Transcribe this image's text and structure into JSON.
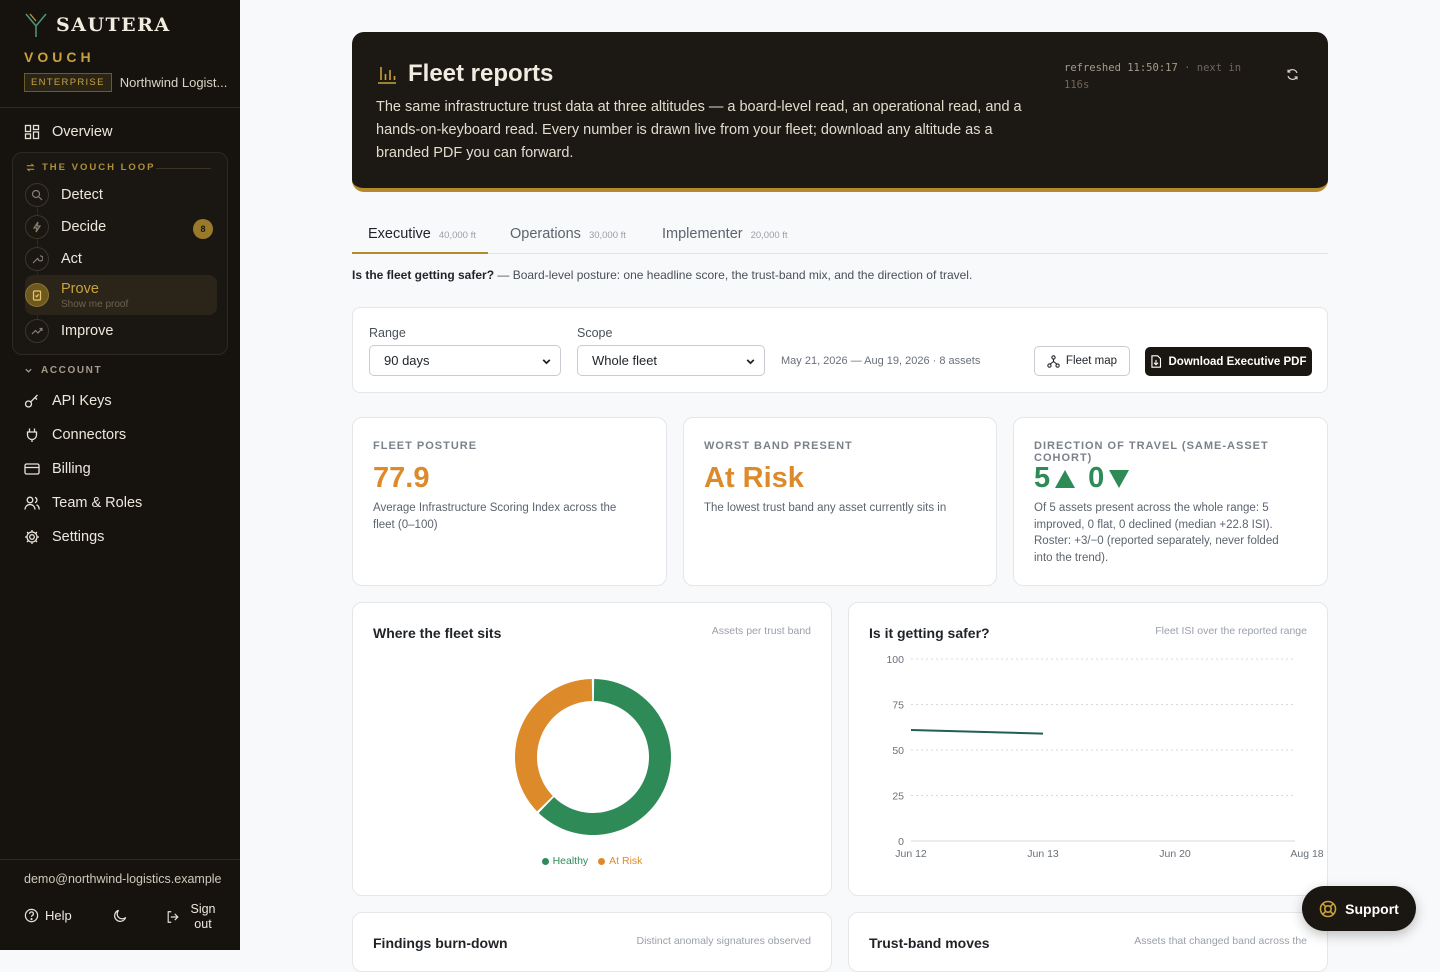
{
  "sidebar": {
    "brand": "SAUTERA",
    "product": "VOUCH",
    "tier": "ENTERPRISE",
    "org": "Northwind Logist...",
    "overview": "Overview",
    "loop_title": "THE VOUCH LOOP",
    "loop": [
      {
        "label": "Detect"
      },
      {
        "label": "Decide",
        "badge": "8"
      },
      {
        "label": "Act"
      },
      {
        "label": "Prove",
        "sub": "Show me proof"
      },
      {
        "label": "Improve"
      }
    ],
    "account_title": "ACCOUNT",
    "account": [
      {
        "label": "API Keys"
      },
      {
        "label": "Connectors"
      },
      {
        "label": "Billing"
      },
      {
        "label": "Team & Roles"
      },
      {
        "label": "Settings"
      }
    ],
    "email": "demo@northwind-logistics.example",
    "help": "Help",
    "signout": "Sign out"
  },
  "hero": {
    "title": "Fleet reports",
    "description": "The same infrastructure trust data at three altitudes — a board-level read, an operational read, and a hands-on-keyboard read. Every number is drawn live from your fleet; download any altitude as a branded PDF you can forward.",
    "refreshed": "refreshed 11:50:17",
    "next": "· next in 116s"
  },
  "tabs": [
    {
      "label": "Executive",
      "alt": "40,000 ft"
    },
    {
      "label": "Operations",
      "alt": "30,000 ft"
    },
    {
      "label": "Implementer",
      "alt": "20,000 ft"
    }
  ],
  "intro": {
    "question": "Is the fleet getting safer?",
    "text": " — Board-level posture: one headline score, the trust-band mix, and the direction of travel."
  },
  "filters": {
    "range_label": "Range",
    "range_value": "90 days",
    "scope_label": "Scope",
    "scope_value": "Whole fleet",
    "date_range": "May 21, 2026 — Aug 19, 2026 · 8 assets",
    "fleet_map": "Fleet map",
    "download": "Download Executive PDF"
  },
  "kpis": {
    "posture": {
      "label": "FLEET POSTURE",
      "value": "77.9",
      "desc": "Average Infrastructure Scoring Index across the fleet (0–100)"
    },
    "band": {
      "label": "WORST BAND PRESENT",
      "value": "At Risk",
      "desc": "The lowest trust band any asset currently sits in"
    },
    "direction": {
      "label": "DIRECTION OF TRAVEL (SAME-ASSET COHORT)",
      "up": "5",
      "down": "0",
      "desc": "Of 5 assets present across the whole range: 5 improved, 0 flat, 0 declined (median +22.8 ISI). Roster: +3/−0 (reported separately, never folded into the trend)."
    }
  },
  "colors": {
    "healthy": "#2e8b57",
    "at_risk": "#dd8a2a",
    "line": "#1f5f55",
    "gold": "#b48a2c"
  },
  "donut": {
    "title": "Where the fleet sits",
    "subtitle": "Assets per trust band",
    "chart_data": {
      "type": "pie",
      "categories": [
        "Healthy",
        "At Risk"
      ],
      "values": [
        5,
        3
      ]
    }
  },
  "trend": {
    "title": "Is it getting safer?",
    "subtitle": "Fleet ISI over the reported range",
    "chart_data": {
      "type": "line",
      "x": [
        "Jun 12",
        "Jun 13"
      ],
      "x_ticks": [
        "Jun 12",
        "Jun 13",
        "Jun 20",
        "Aug 18"
      ],
      "series": [
        {
          "values": [
            61,
            59
          ]
        }
      ],
      "ylim": [
        0,
        100
      ],
      "yticks": [
        0,
        25,
        50,
        75,
        100
      ],
      "grid": true
    }
  },
  "lower": {
    "burn_title": "Findings burn-down",
    "burn_sub": "Distinct anomaly signatures observed",
    "moves_title": "Trust-band moves",
    "moves_sub": "Assets that changed band across the"
  },
  "support": "Support"
}
